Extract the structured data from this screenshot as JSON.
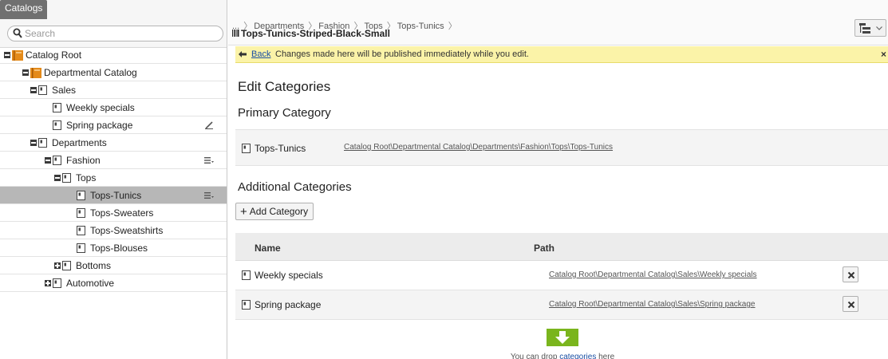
{
  "left_panel": {
    "tab_label": "Catalogs",
    "search_placeholder": "Search",
    "tree": [
      {
        "label": "Catalog Root",
        "expanded": true,
        "icon": "catalog-icon"
      },
      {
        "label": "Departmental Catalog",
        "expanded": true,
        "icon": "catalog-icon"
      },
      {
        "label": "Sales",
        "expanded": true,
        "icon": "category-icon"
      },
      {
        "label": "Weekly specials",
        "icon": "category-icon"
      },
      {
        "label": "Spring package",
        "icon": "category-icon",
        "action_icon": "pencil-icon"
      },
      {
        "label": "Departments",
        "expanded": true,
        "icon": "category-icon"
      },
      {
        "label": "Fashion",
        "expanded": true,
        "icon": "category-icon",
        "action_icon": "menu-icon"
      },
      {
        "label": "Tops",
        "expanded": true,
        "icon": "category-icon"
      },
      {
        "label": "Tops-Tunics",
        "icon": "category-icon",
        "selected": true,
        "action_icon": "menu-icon"
      },
      {
        "label": "Tops-Sweaters",
        "icon": "category-icon"
      },
      {
        "label": "Tops-Sweatshirts",
        "icon": "category-icon"
      },
      {
        "label": "Tops-Blouses",
        "icon": "category-icon"
      },
      {
        "label": "Bottoms",
        "expanded": false,
        "icon": "category-icon"
      },
      {
        "label": "Automotive",
        "expanded": false,
        "icon": "category-icon"
      }
    ]
  },
  "header": {
    "breadcrumb": [
      "...",
      "Departments",
      "Fashion",
      "Tops",
      "Tops-Tunics"
    ],
    "item_title": "Tops-Tunics-Striped-Black-Small"
  },
  "notice": {
    "back_label": "Back",
    "message": "Changes made here will be published immediately while you edit.",
    "close_label": "×"
  },
  "main": {
    "title": "Edit Categories",
    "primary_heading": "Primary Category",
    "primary": {
      "name": "Tops-Tunics",
      "path": "Catalog Root\\Departmental Catalog\\Departments\\Fashion\\Tops\\Tops-Tunics"
    },
    "additional_heading": "Additional Categories",
    "add_button_label": "Add Category",
    "table": {
      "col_name": "Name",
      "col_path": "Path",
      "rows": [
        {
          "name": "Weekly specials",
          "path": "Catalog Root\\Departmental Catalog\\Sales\\Weekly specials"
        },
        {
          "name": "Spring package",
          "path": "Catalog Root\\Departmental Catalog\\Sales\\Spring package"
        }
      ]
    },
    "drop_text_prefix": "You can drop ",
    "drop_text_link": "categories",
    "drop_text_suffix": " here"
  },
  "colors": {
    "notice_bg": "#fbf3a8",
    "selected_row": "#b7b7b7",
    "drop_accent": "#7ab51d",
    "link": "#1a4fa3"
  }
}
